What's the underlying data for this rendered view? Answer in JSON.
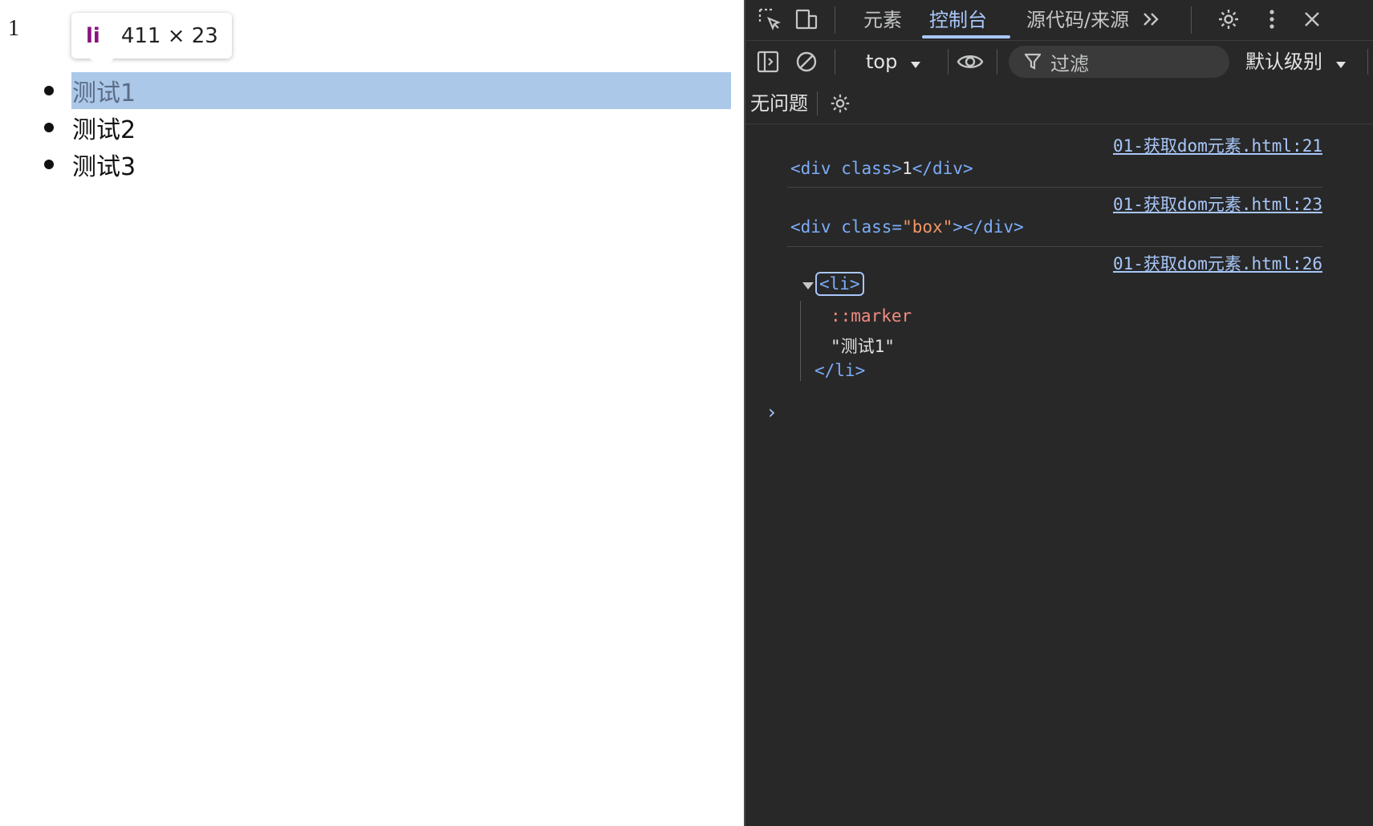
{
  "page": {
    "div_text": "1",
    "tooltip": {
      "tag": "li",
      "size": "411 × 23"
    },
    "list_items": [
      "测试1",
      "测试2",
      "测试3"
    ]
  },
  "devtools": {
    "tabs": [
      "元素",
      "控制台",
      "源代码/来源"
    ],
    "active_tab": "控制台",
    "toolbar": {
      "context": "top",
      "filter_placeholder": "过滤",
      "level": "默认级别"
    },
    "issues_label": "无问题",
    "logs": [
      {
        "source": "01-获取dom元素.html:21",
        "open_tag": "<div class>",
        "text": "1",
        "close_tag": "</div>"
      },
      {
        "source": "01-获取dom元素.html:23",
        "open_tag_start": "<div class=",
        "attr_value": "\"box\"",
        "open_tag_end": ">",
        "close_tag": "</div>"
      },
      {
        "source": "01-获取dom元素.html:26",
        "open_tag": "<li>",
        "marker": "::marker",
        "text": "\"测试1\"",
        "close_tag": "</li>"
      }
    ],
    "prompt": "›",
    "colors": {
      "background": "#282828",
      "accent": "#a8c7fa",
      "tag": "#7cacf8",
      "attr_value": "#f29766",
      "pseudo": "#f28b82",
      "highlight": "#6fa1d9"
    },
    "icons": [
      "inspect-icon",
      "device-toolbar-icon",
      "more-tabs-icon",
      "settings-icon",
      "kebab-menu-icon",
      "close-icon",
      "sidebar-toggle-icon",
      "clear-console-icon",
      "dropdown-caret-icon",
      "eye-icon",
      "filter-icon",
      "gear-icon",
      "expand-triangle-icon"
    ]
  }
}
